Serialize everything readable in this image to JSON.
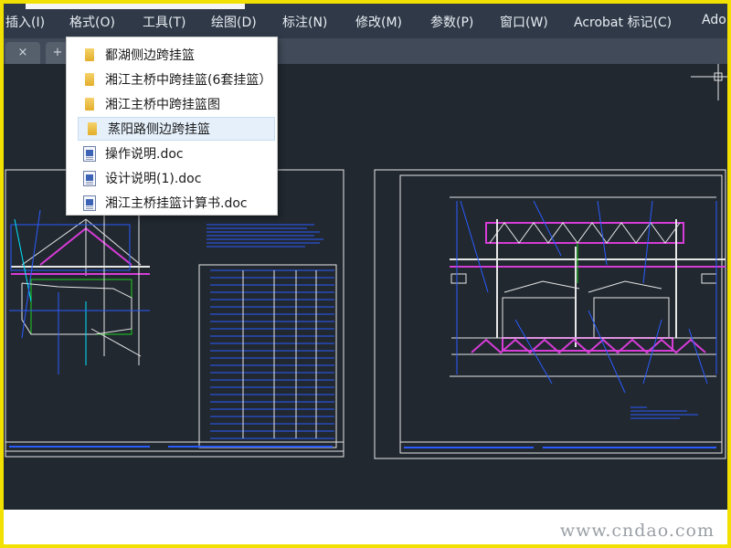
{
  "menubar": {
    "items": [
      {
        "label": "插入(I)"
      },
      {
        "label": "格式(O)"
      },
      {
        "label": "工具(T)"
      },
      {
        "label": "绘图(D)"
      },
      {
        "label": "标注(N)"
      },
      {
        "label": "修改(M)"
      },
      {
        "label": "参数(P)"
      },
      {
        "label": "窗口(W)"
      },
      {
        "label": "Acrobat 标记(C)"
      },
      {
        "label": "Ado"
      }
    ]
  },
  "tabs": {
    "close_symbol": "×",
    "new_symbol": "+"
  },
  "popup": {
    "items": [
      {
        "label": "鄱湖侧边跨挂篮",
        "icon": "folder-icon"
      },
      {
        "label": "湘江主桥中跨挂篮(6套挂篮）",
        "icon": "folder-icon"
      },
      {
        "label": "湘江主桥中跨挂篮图",
        "icon": "folder-icon"
      },
      {
        "label": "蒸阳路侧边跨挂篮",
        "icon": "folder-icon",
        "selected": true
      },
      {
        "label": "操作说明.doc",
        "icon": "word-doc-icon"
      },
      {
        "label": "设计说明(1).doc",
        "icon": "word-doc-icon"
      },
      {
        "label": "湘江主桥挂篮计算书.doc",
        "icon": "word-doc-icon"
      }
    ]
  },
  "watermark": {
    "text": "www.cndao.com"
  },
  "colors": {
    "frame": "#f2e100",
    "menubar": "#2f3947",
    "canvas": "#212830",
    "cad_white": "#e6e6e6",
    "cad_cyan": "#00e5ff",
    "cad_blue": "#2b5cff",
    "cad_magenta": "#d63cd6",
    "cad_green": "#1fd11f"
  }
}
